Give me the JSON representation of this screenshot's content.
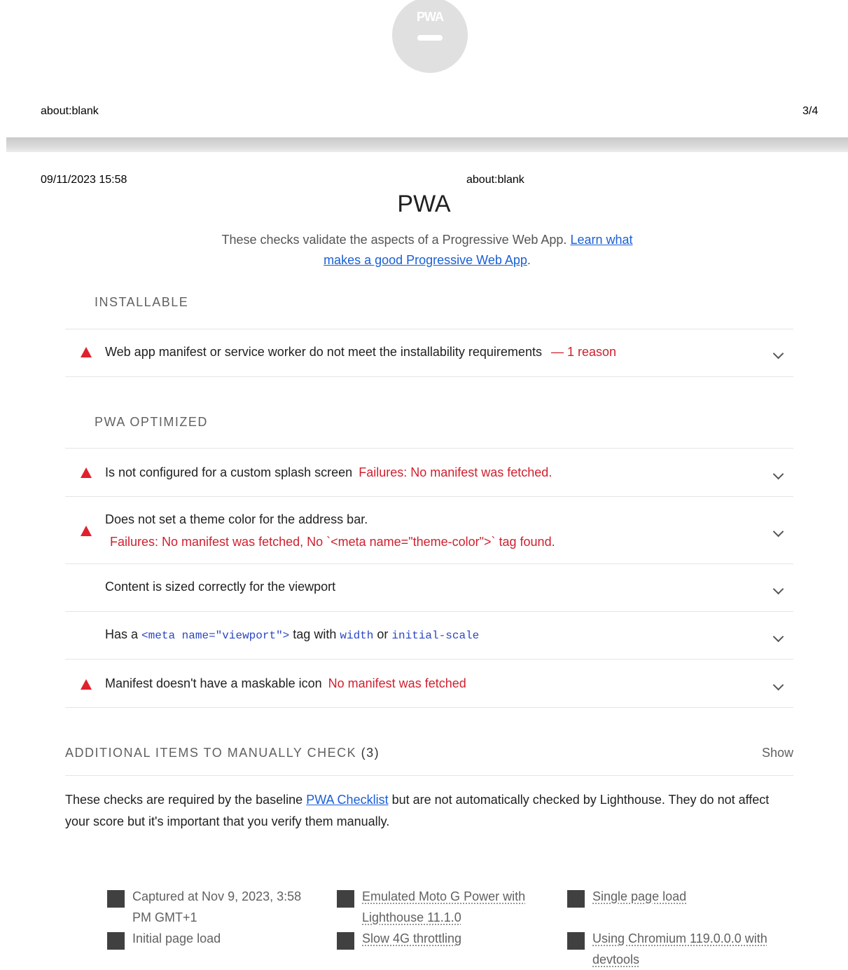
{
  "badge": {
    "label": "PWA",
    "icon": "pwa-badge-icon",
    "color": "#e0e0e0"
  },
  "page_header": {
    "url": "about:blank",
    "page_count": "3/4"
  },
  "header": {
    "date": "09/11/2023 15:58",
    "url": "about:blank"
  },
  "category": {
    "title": "PWA",
    "description": "These checks validate the aspects of a Progressive Web App.",
    "learn_link": "Learn what makes a good Progressive Web App",
    "learn_suffix": "."
  },
  "installable": {
    "title": "INSTALLABLE",
    "audits": [
      {
        "title": "Web app manifest or service worker do not meet the installability requirements",
        "detail": "— 1 reason",
        "status": "fail"
      }
    ]
  },
  "optimized": {
    "title": "PWA OPTIMIZED",
    "audits": [
      {
        "title": "Is not configured for a custom splash screen",
        "detail": "Failures: No manifest was fetched.",
        "status": "fail"
      },
      {
        "title": "Does not set a theme color for the address bar.",
        "detail": "Failures: No manifest was fetched, No `<meta name=\"theme-color\">` tag found.",
        "status": "fail"
      },
      {
        "title": "Content is sized correctly for the viewport",
        "status": "pass"
      },
      {
        "title_prefix": "Has a",
        "code1": "<meta name=\"viewport\">",
        "mid1": "tag with",
        "code2": "width",
        "mid2": "or",
        "code3": "initial-scale",
        "status": "pass"
      },
      {
        "title": "Manifest doesn't have a maskable icon",
        "detail": "No manifest was fetched",
        "status": "fail"
      }
    ]
  },
  "manual": {
    "title": "ADDITIONAL ITEMS TO MANUALLY CHECK",
    "count": "(3)",
    "show_label": "Show",
    "desc_prefix": "These checks are required by the baseline",
    "desc_link": "PWA Checklist",
    "desc_suffix": "but are not automatically checked by Lighthouse. They do not affect your score but it's important that you verify them manually."
  },
  "footer": {
    "captured_line1": "Captured at Nov 9, 2023, 3:58",
    "captured_line2": "PM GMT+1",
    "initial_load": "Initial page load",
    "device_line1": "Emulated Moto G Power with",
    "device_line2": "Lighthouse 11.1.0",
    "throttling": "Slow 4G throttling",
    "single_load": "Single page load",
    "chromium_line1": "Using Chromium 119.0.0.0 with",
    "chromium_line2": "devtools"
  },
  "colors": {
    "fail": "#d0202e",
    "link": "#1a5fd6",
    "warn_icon": "#e0212d"
  }
}
